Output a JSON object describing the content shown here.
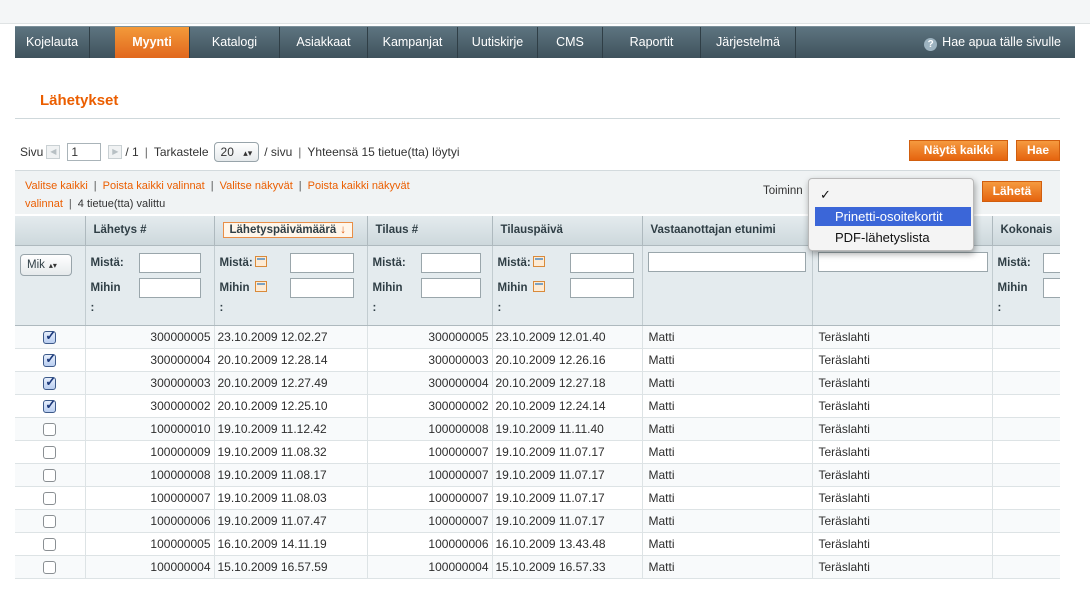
{
  "nav": {
    "items": [
      "Kojelauta",
      "Myynti",
      "Katalogi",
      "Asiakkaat",
      "Kampanjat",
      "Uutiskirje",
      "CMS",
      "Raportit",
      "Järjestelmä"
    ],
    "help": "Hae apua tälle sivulle"
  },
  "page": {
    "title": "Lähetykset"
  },
  "pager": {
    "page_label": "Sivu",
    "page_value": "1",
    "total_pages": "/ 1",
    "view_label": "Tarkastele",
    "per_page": "20",
    "per_page_suffix": "/ sivu",
    "total_text": "Yhteensä 15 tietue(tta) löytyi"
  },
  "buttons": {
    "show_all": "Näytä kaikki",
    "search": "Hae",
    "submit": "Lähetä"
  },
  "massaction": {
    "select_all": "Valitse kaikki",
    "unselect_all": "Poista kaikki valinnat",
    "select_visible": "Valitse näkyvät",
    "unselect_visible_1": "Poista kaikki näkyvät",
    "unselect_visible_2": "valinnat",
    "selected_count": "4 tietue(tta) valittu",
    "action_label": "Toiminn"
  },
  "dropdown": {
    "options": [
      "",
      "Prinetti-osoitekortit",
      "PDF-lähetyslista"
    ],
    "highlighted": "Prinetti-osoitekortit",
    "check": "✓"
  },
  "columns": [
    "",
    "Lähetys #",
    "Lähetyspäivämäärä",
    "Tilaus #",
    "Tilauspäivä",
    "Vastaanottajan etunimi",
    "",
    "Kokonais"
  ],
  "sort_arrow": "↓",
  "filters": {
    "any_select": "Mik",
    "from": "Mistä:",
    "to": "Mihin",
    "colon": ":"
  },
  "rows": [
    {
      "checked": true,
      "shipment": "300000005",
      "ship_date": "23.10.2009 12.02.27",
      "order": "300000005",
      "order_date": "23.10.2009 12.01.40",
      "first": "Matti",
      "last": "Teräslahti"
    },
    {
      "checked": true,
      "shipment": "300000004",
      "ship_date": "20.10.2009 12.28.14",
      "order": "300000003",
      "order_date": "20.10.2009 12.26.16",
      "first": "Matti",
      "last": "Teräslahti"
    },
    {
      "checked": true,
      "shipment": "300000003",
      "ship_date": "20.10.2009 12.27.49",
      "order": "300000004",
      "order_date": "20.10.2009 12.27.18",
      "first": "Matti",
      "last": "Teräslahti"
    },
    {
      "checked": true,
      "shipment": "300000002",
      "ship_date": "20.10.2009 12.25.10",
      "order": "300000002",
      "order_date": "20.10.2009 12.24.14",
      "first": "Matti",
      "last": "Teräslahti"
    },
    {
      "checked": false,
      "shipment": "100000010",
      "ship_date": "19.10.2009 11.12.42",
      "order": "100000008",
      "order_date": "19.10.2009 11.11.40",
      "first": "Matti",
      "last": "Teräslahti"
    },
    {
      "checked": false,
      "shipment": "100000009",
      "ship_date": "19.10.2009 11.08.32",
      "order": "100000007",
      "order_date": "19.10.2009 11.07.17",
      "first": "Matti",
      "last": "Teräslahti"
    },
    {
      "checked": false,
      "shipment": "100000008",
      "ship_date": "19.10.2009 11.08.17",
      "order": "100000007",
      "order_date": "19.10.2009 11.07.17",
      "first": "Matti",
      "last": "Teräslahti"
    },
    {
      "checked": false,
      "shipment": "100000007",
      "ship_date": "19.10.2009 11.08.03",
      "order": "100000007",
      "order_date": "19.10.2009 11.07.17",
      "first": "Matti",
      "last": "Teräslahti"
    },
    {
      "checked": false,
      "shipment": "100000006",
      "ship_date": "19.10.2009 11.07.47",
      "order": "100000007",
      "order_date": "19.10.2009 11.07.17",
      "first": "Matti",
      "last": "Teräslahti"
    },
    {
      "checked": false,
      "shipment": "100000005",
      "ship_date": "16.10.2009 14.11.19",
      "order": "100000006",
      "order_date": "16.10.2009 13.43.48",
      "first": "Matti",
      "last": "Teräslahti"
    },
    {
      "checked": false,
      "shipment": "100000004",
      "ship_date": "15.10.2009 16.57.59",
      "order": "100000004",
      "order_date": "15.10.2009 16.57.33",
      "first": "Matti",
      "last": "Teräslahti"
    }
  ]
}
